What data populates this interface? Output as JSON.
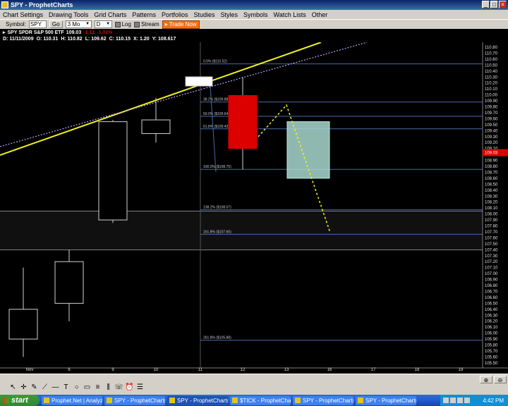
{
  "window": {
    "title": "SPY - ProphetCharts",
    "minimize": "_",
    "maximize": "□",
    "close": "×"
  },
  "menu": [
    "Chart Settings",
    "Drawing Tools",
    "Grid Charts",
    "Patterns",
    "Portfolios",
    "Studies",
    "Styles",
    "Symbols",
    "Watch Lists",
    "Other"
  ],
  "toolbar": {
    "symbol_label": "Symbol:",
    "symbol_value": "SPY",
    "go_label": "Go",
    "period_value": "3 Mo",
    "interval_value": "D",
    "log_label": "Log",
    "stream_label": "Stream",
    "trade_label": "Trade Now"
  },
  "info": {
    "symbol_line": "SPY SPDR S&P 500 ETF",
    "last": "109.03",
    "change": "-1.12",
    "change_pct": "-1.02%",
    "date": "D: 11/11/2009",
    "open": "O: 110.31",
    "high": "H: 110.82",
    "low": "L: 109.62",
    "close": "C: 110.15",
    "x": "X: 1.20",
    "y": "Y: 108.617"
  },
  "chart_data": {
    "type": "candlestick",
    "x_labels": [
      "Nov",
      "6",
      "9",
      "10",
      "11",
      "12",
      "13",
      "16",
      "17",
      "18",
      "19"
    ],
    "y_ticks": [
      "110.80",
      "110.70",
      "110.60",
      "110.50",
      "110.40",
      "110.30",
      "110.20",
      "110.10",
      "110.00",
      "109.90",
      "109.80",
      "109.70",
      "109.60",
      "109.50",
      "109.40",
      "109.30",
      "109.20",
      "109.10",
      "109.00",
      "108.90",
      "108.80",
      "108.70",
      "108.60",
      "108.50",
      "108.40",
      "108.30",
      "108.20",
      "108.10",
      "108.00",
      "107.90",
      "107.80",
      "107.70",
      "107.60",
      "107.50",
      "107.40",
      "107.30",
      "107.20",
      "107.10",
      "107.00",
      "106.90",
      "106.80",
      "106.70",
      "106.60",
      "106.50",
      "106.40",
      "106.30",
      "106.20",
      "106.10",
      "106.00",
      "105.90",
      "105.80",
      "105.70",
      "105.60",
      "105.50"
    ],
    "current_price_label": "109.03",
    "candles": [
      {
        "date": "Nov 5",
        "open": 105.9,
        "close": 106.4,
        "high": 107.1,
        "low": 105.6,
        "color": "#000000"
      },
      {
        "date": "Nov 6",
        "open": 106.5,
        "close": 107.2,
        "high": 107.4,
        "low": 106.2,
        "color": "#000000"
      },
      {
        "date": "Nov 9",
        "open": 107.9,
        "close": 109.55,
        "high": 109.58,
        "low": 107.85,
        "color": "#000000"
      },
      {
        "date": "Nov 10",
        "open": 109.35,
        "close": 109.58,
        "high": 109.95,
        "low": 109.2,
        "color": "#000000"
      },
      {
        "date": "Nov 12",
        "open": 109.99,
        "close": 109.1,
        "high": 110.3,
        "low": 108.75,
        "color": "#dd0000"
      }
    ],
    "projection_box": {
      "date": "Nov 13",
      "top": 109.55,
      "bottom": 108.6,
      "color": "#a8d8d0"
    },
    "fib_levels": [
      {
        "label": "0.0%  ($110.52)",
        "price": 110.52
      },
      {
        "label": "38.2%  ($109.88)",
        "price": 109.88
      },
      {
        "label": "50.0%  ($109.64)",
        "price": 109.64
      },
      {
        "label": "61.8%  ($109.43)",
        "price": 109.43
      },
      {
        "label": "100.0%  ($108.75)",
        "price": 108.75
      },
      {
        "label": "138.2%  ($108.07)",
        "price": 108.07
      },
      {
        "label": "161.8%  ($107.66)",
        "price": 107.66
      },
      {
        "label": "261.8%  ($105.88)",
        "price": 105.88
      }
    ],
    "grid": true
  },
  "draw_tools": [
    "pointer-icon",
    "crosshair-icon",
    "pencil-icon",
    "ray-icon",
    "hline-icon",
    "text-icon",
    "ellipse-icon",
    "rect-icon",
    "fib-icon",
    "channel-icon",
    "speech-icon",
    "alarm-icon",
    "list-icon"
  ],
  "taskbar": {
    "start": "start",
    "tasks": [
      {
        "label": "Prophet.Net | Analyz...",
        "active": false
      },
      {
        "label": "SPY - ProphetCharts",
        "active": false
      },
      {
        "label": "SPY - ProphetCharts",
        "active": true
      },
      {
        "label": "$TICK - ProphetCharts",
        "active": false
      },
      {
        "label": "SPY - ProphetCharts",
        "active": false
      },
      {
        "label": "SPY - ProphetCharts",
        "active": false
      }
    ],
    "clock": "4:42 PM"
  }
}
